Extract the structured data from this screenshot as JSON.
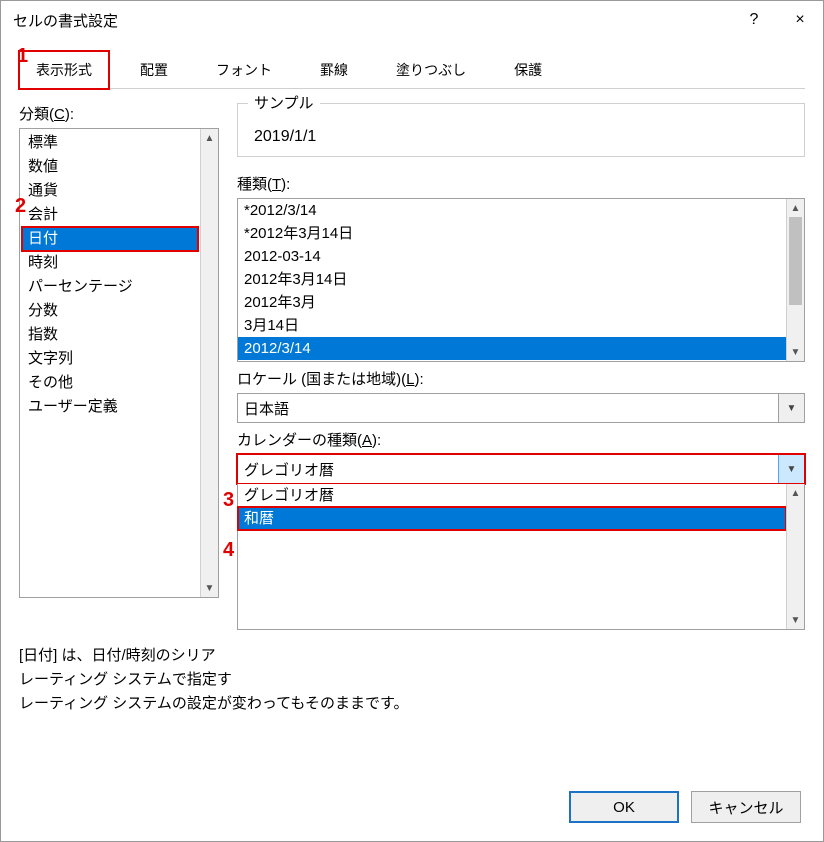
{
  "dialog": {
    "title": "セルの書式設定",
    "help": "?",
    "close": "×"
  },
  "tabs": {
    "items": [
      "表示形式",
      "配置",
      "フォント",
      "罫線",
      "塗りつぶし",
      "保護"
    ],
    "active_index": 0
  },
  "annotations": {
    "n1": "1",
    "n2": "2",
    "n3": "3",
    "n4": "4"
  },
  "category": {
    "label_pre": "分類(",
    "label_key": "C",
    "label_post": "):",
    "items": [
      "標準",
      "数値",
      "通貨",
      "会計",
      "日付",
      "時刻",
      "パーセンテージ",
      "分数",
      "指数",
      "文字列",
      "その他",
      "ユーザー定義"
    ],
    "selected_index": 4
  },
  "sample": {
    "legend": "サンプル",
    "value": "2019/1/1"
  },
  "type": {
    "label_pre": "種類(",
    "label_key": "T",
    "label_post": "):",
    "items": [
      "*2012/3/14",
      "*2012年3月14日",
      "2012-03-14",
      "2012年3月14日",
      "2012年3月",
      "3月14日",
      "2012/3/14"
    ],
    "selected_index": 6
  },
  "locale": {
    "label_pre": "ロケール (国または地域)(",
    "label_key": "L",
    "label_post": "):",
    "value": "日本語"
  },
  "calendar": {
    "label_pre": "カレンダーの種類(",
    "label_key": "A",
    "label_post": "):",
    "value": "グレゴリオ暦",
    "options": [
      "グレゴリオ暦",
      "和暦"
    ],
    "dropdown_selected_index": 1
  },
  "description": {
    "line1": "[日付] は、日付/時刻のシリア",
    "line2": "レーティング システムで指定す",
    "line3": "レーティング システムの設定が変わってもそのままです。"
  },
  "buttons": {
    "ok": "OK",
    "cancel": "キャンセル"
  }
}
